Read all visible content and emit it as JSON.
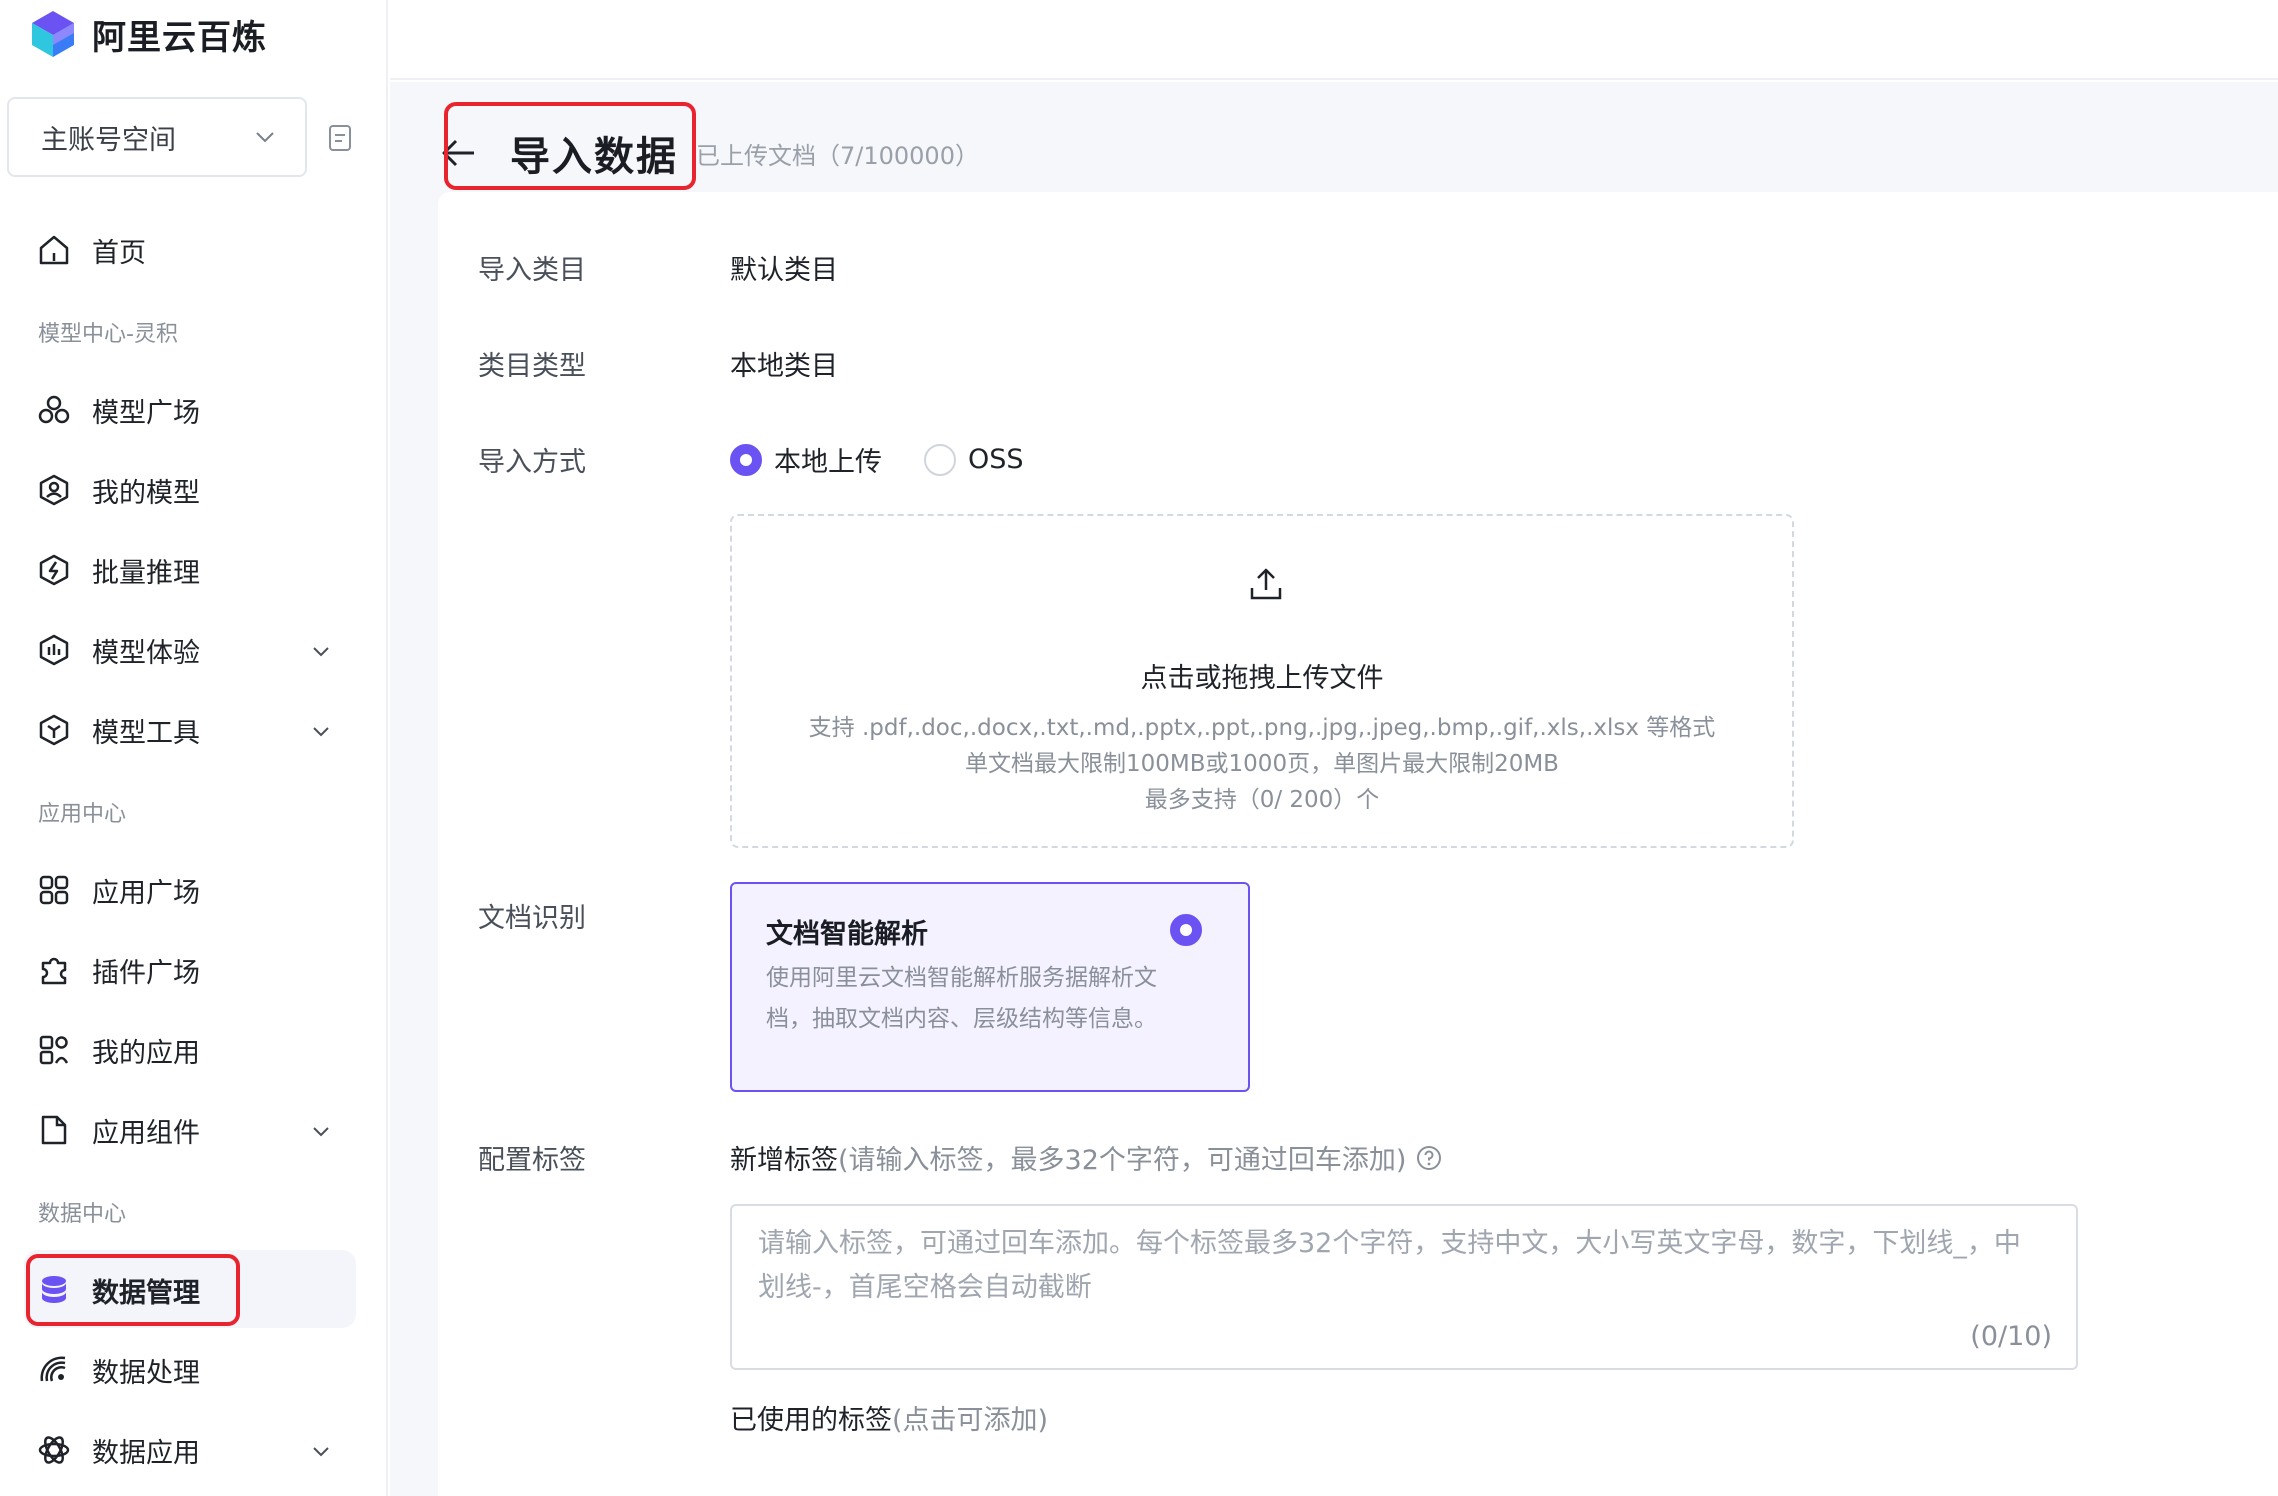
{
  "brand": {
    "name": "阿里云百炼"
  },
  "workspace": {
    "label": "主账号空间"
  },
  "sidebar": {
    "home": "首页",
    "section_model": "模型中心-灵积",
    "model_items": [
      "模型广场",
      "我的模型",
      "批量推理",
      "模型体验",
      "模型工具"
    ],
    "section_app": "应用中心",
    "app_items": [
      "应用广场",
      "插件广场",
      "我的应用",
      "应用组件"
    ],
    "section_data": "数据中心",
    "data_items": [
      "数据管理",
      "数据处理",
      "数据应用"
    ],
    "active_item": "数据管理"
  },
  "header": {
    "title": "导入数据",
    "upload_count": "已上传文档（7/100000）"
  },
  "form": {
    "category_label": "导入类目",
    "category_value": "默认类目",
    "category_type_label": "类目类型",
    "category_type_value": "本地类目",
    "import_method_label": "导入方式",
    "import_options": [
      "本地上传",
      "OSS"
    ],
    "import_selected": "本地上传",
    "dropzone": {
      "title": "点击或拖拽上传文件",
      "formats": "支持 .pdf,.doc,.docx,.txt,.md,.pptx,.ppt,.png,.jpg,.jpeg,.bmp,.gif,.xls,.xlsx 等格式",
      "limits": "单文档最大限制100MB或1000页，单图片最大限制20MB",
      "max_count": "最多支持（0/ 200）个"
    },
    "doc_recognition_label": "文档识别",
    "parse_option": {
      "title": "文档智能解析",
      "description": "使用阿里云文档智能解析服务据解析文档，抽取文档内容、层级结构等信息。"
    },
    "tags_label": "配置标签",
    "new_tag_label": "新增标签",
    "new_tag_hint": "(请输入标签，最多32个字符，可通过回车添加)",
    "tag_placeholder": "请输入标签，可通过回车添加。每个标签最多32个字符，支持中文，大小写英文字母，数字，下划线_，中划线-，首尾空格会自动截断",
    "tag_count": "(0/10)",
    "used_tags_label": "已使用的标签",
    "used_tags_hint": "(点击可添加)"
  },
  "colors": {
    "accent": "#6b52f2",
    "highlight": "#e8242e"
  }
}
